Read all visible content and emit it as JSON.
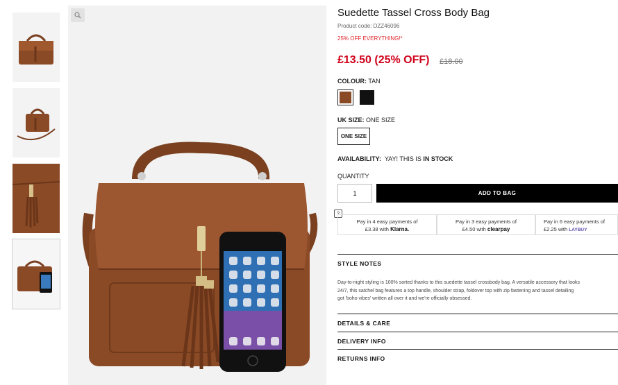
{
  "product": {
    "title": "Suedette Tassel Cross Body Bag",
    "code": "Product code: DZZ46096",
    "promo": "25% OFF EVERYTHING!*",
    "price": "£13.50 (25% OFF)",
    "was_price": "£18.00"
  },
  "colour": {
    "label": "COLOUR:",
    "value": "TAN",
    "swatches": [
      {
        "name": "tan",
        "hex": "#8b4a26"
      },
      {
        "name": "black",
        "hex": "#111111"
      }
    ]
  },
  "size": {
    "label": "UK SIZE:",
    "value": "ONE SIZE",
    "option": "ONE SIZE"
  },
  "availability": {
    "label": "AVAILABILITY:",
    "text": "YAY! THIS IS",
    "status": "IN STOCK"
  },
  "quantity": {
    "label": "QUANTITY",
    "value": "1"
  },
  "add_to_bag": "ADD TO BAG",
  "help_icon": "?",
  "payments": [
    {
      "line1": "Pay in 4 easy payments of",
      "amount": "£3.38 with",
      "brand": "Klarna."
    },
    {
      "line1": "Pay in 3 easy payments of",
      "amount": "£4.50 with",
      "brand": "clearpay"
    },
    {
      "line1": "Pay in 6 easy payments of",
      "amount": "£2.25 with",
      "brand": "LAYBUY"
    }
  ],
  "style_notes": {
    "heading": "STYLE NOTES",
    "lines": [
      "Day-to-night styling is 100% sorted thanks to this suedette tassel crossbody bag. A versatile accessory that looks",
      "24/7, this satchel bag features a top handle, shoulder strap, foldover top with zip fastening and tassel detailing",
      "got 'boho vibes' written all over it and we're officially obsessed."
    ]
  },
  "sections": [
    "DETAILS & CARE",
    "DELIVERY INFO",
    "RETURNS INFO"
  ],
  "icons": {
    "zoom": "magnifier-icon",
    "klarna": "klarna-logo",
    "clearpay": "clearpay-logo",
    "laybuy": "laybuy-logo"
  },
  "colors": {
    "accent_red": "#d0021b",
    "brand_black": "#000000",
    "bag_tan": "#8b4a26"
  }
}
